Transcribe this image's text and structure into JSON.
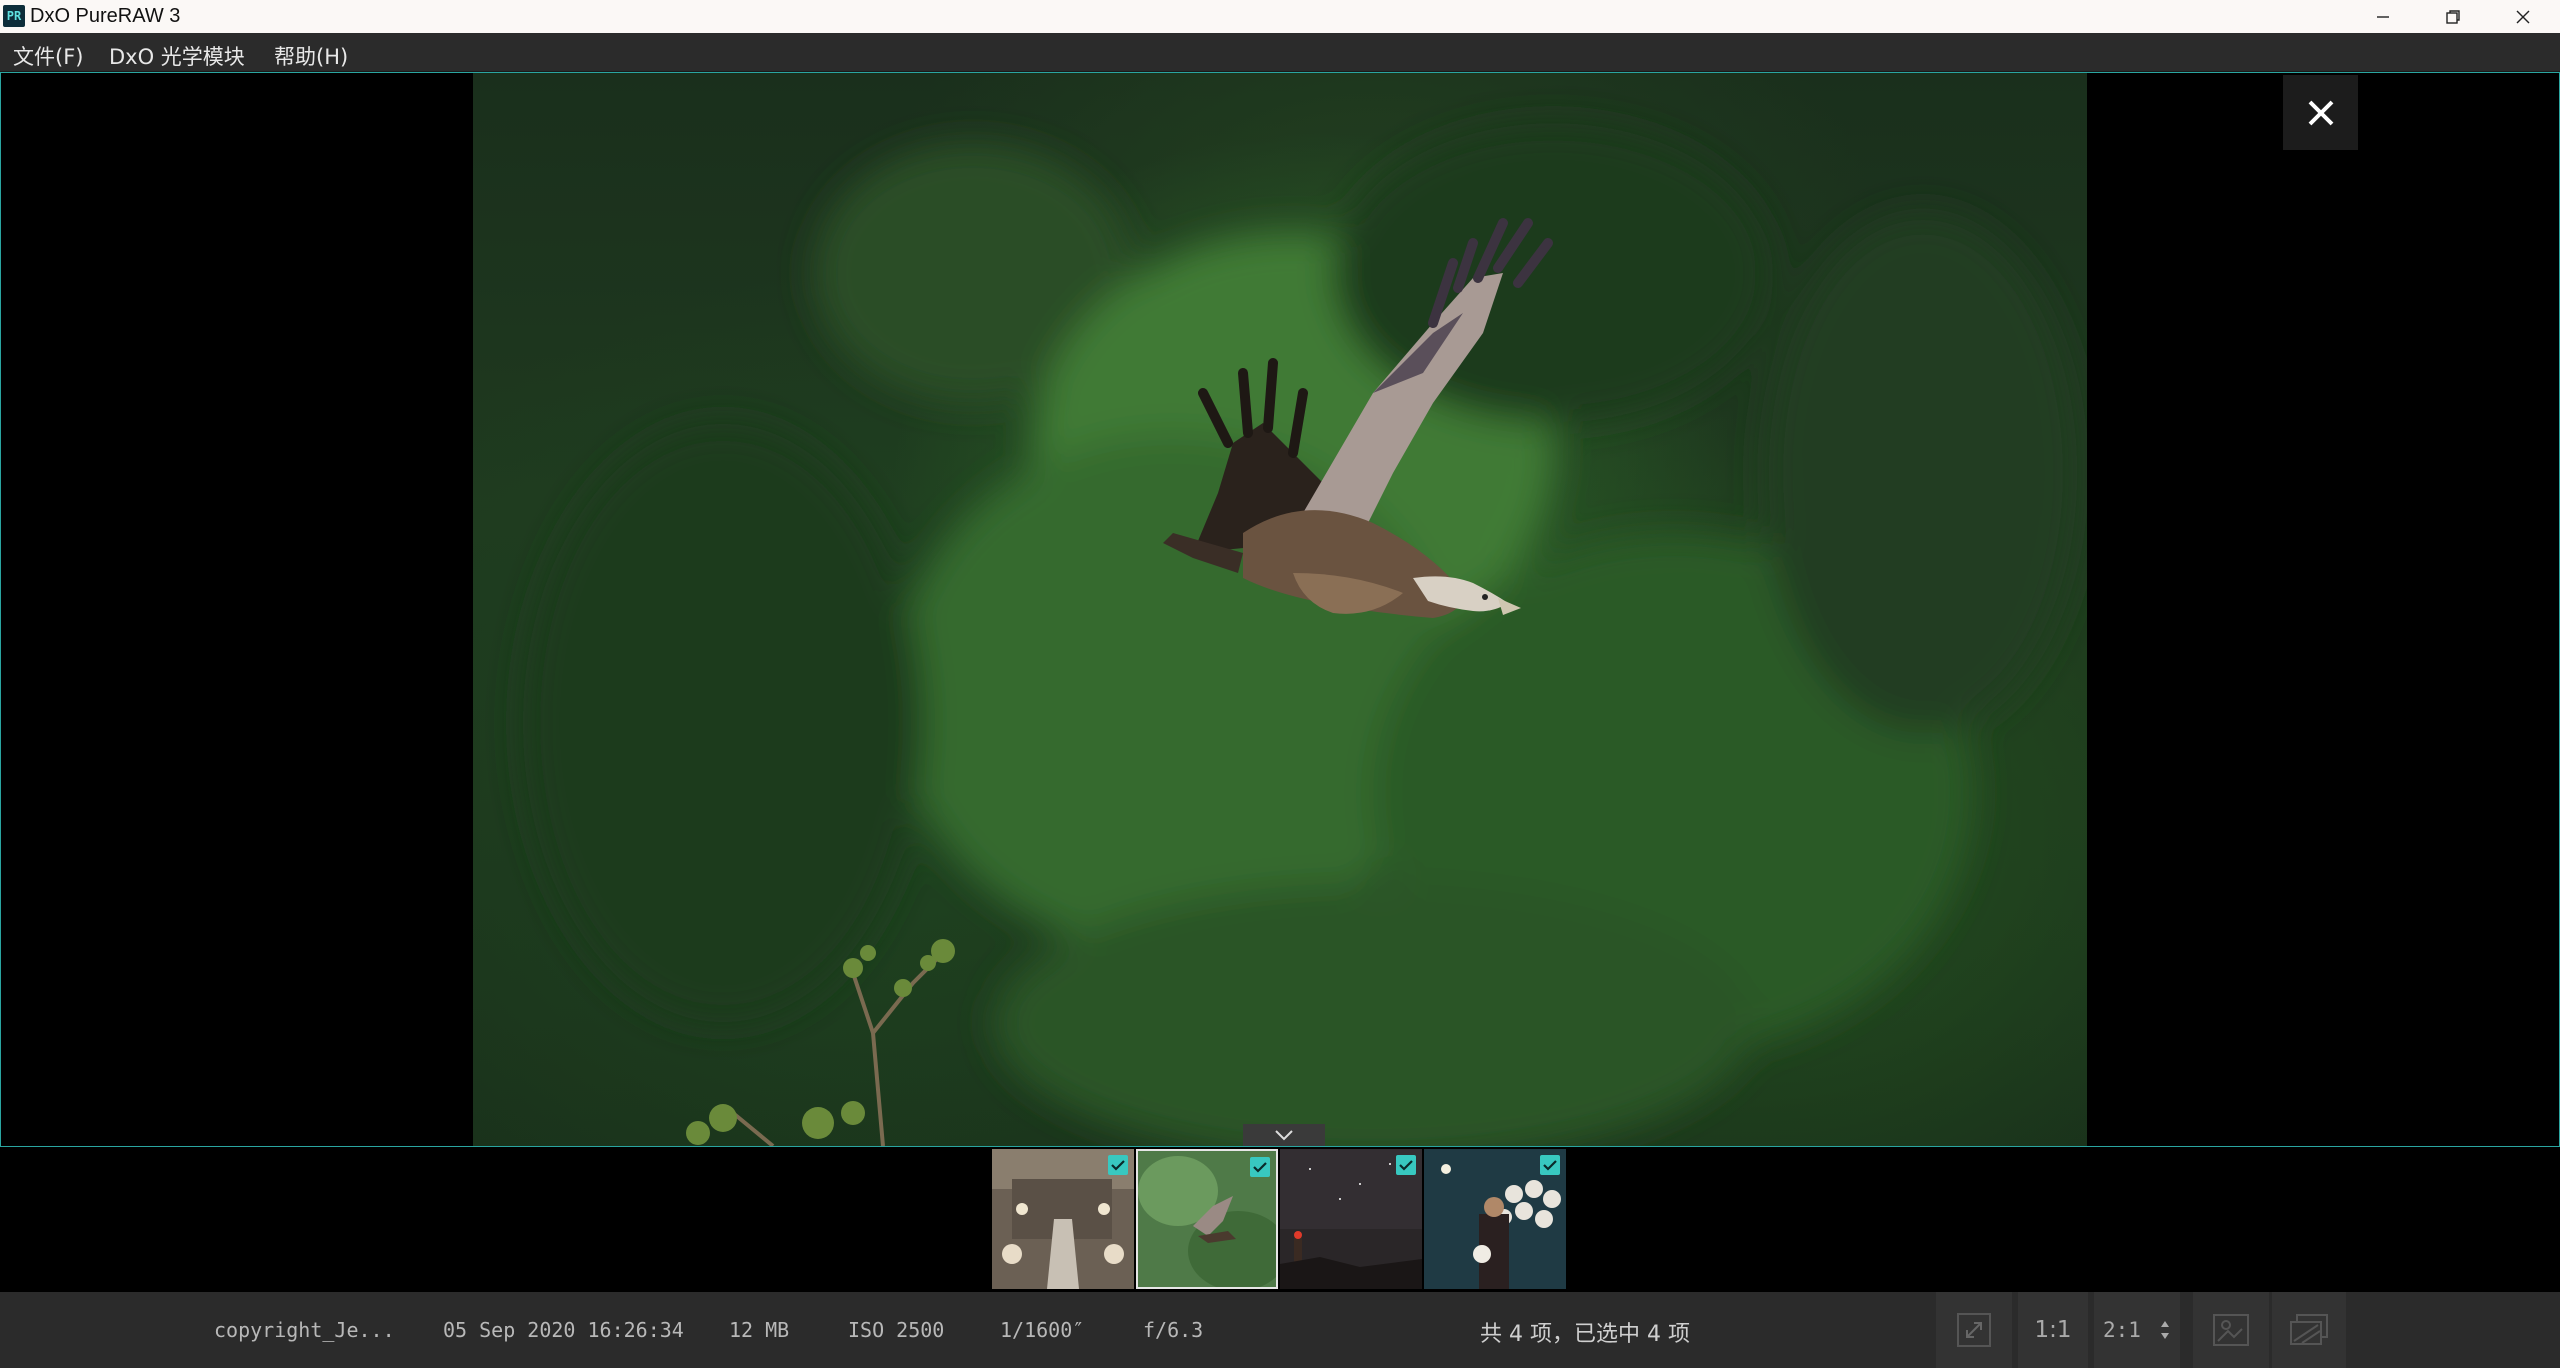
{
  "window": {
    "app_icon_text": "PR",
    "title": "DxO PureRAW 3"
  },
  "menu": {
    "items": [
      "文件(F)",
      "DxO 光学模块",
      "帮助(H)"
    ]
  },
  "viewer": {
    "close_icon": "close-icon",
    "collapse_icon": "chevron-down-icon"
  },
  "filmstrip": {
    "thumbnails": [
      {
        "name": "opera-house-staircase",
        "checked": true,
        "selected": false
      },
      {
        "name": "vulture-in-flight",
        "checked": true,
        "selected": true
      },
      {
        "name": "lighthouse-night-sky",
        "checked": true,
        "selected": false
      },
      {
        "name": "portrait-with-plates",
        "checked": true,
        "selected": false
      }
    ]
  },
  "status": {
    "copyright": "copyright_Je...",
    "datetime": "05 Sep 2020 16:26:34",
    "size": "12 MB",
    "iso": "ISO 2500",
    "shutter": "1/1600″",
    "aperture": "f/6.3",
    "selection": "共 4 项，已选中 4 项",
    "zoom_1to1": "1:1",
    "zoom_2to1": "2:1"
  },
  "colors": {
    "accent": "#38c8c0",
    "border": "#2aa5a0"
  }
}
